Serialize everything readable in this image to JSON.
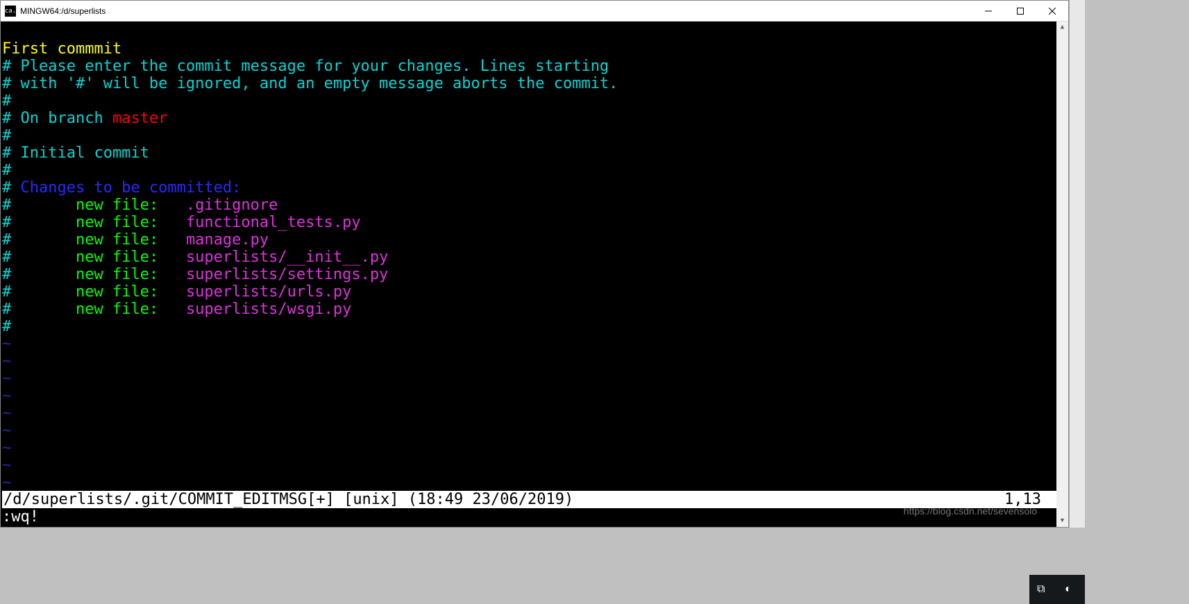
{
  "window": {
    "title": "MINGW64:/d/superlists",
    "icon_text": "ca."
  },
  "editor": {
    "commit_message": "First commmit",
    "comment_line1": "# Please enter the commit message for your changes. Lines starting",
    "comment_line2": "# with '#' will be ignored, and an empty message aborts the commit.",
    "hash_blank": "#",
    "on_branch_prefix": "# On branch ",
    "branch_name": "master",
    "initial_commit": "# Initial commit",
    "changes_prefix": "# ",
    "changes_header": "Changes to be committed:",
    "file_label": "new file:",
    "files": [
      ".gitignore",
      "functional_tests.py",
      "manage.py",
      "superlists/__init__.py",
      "superlists/settings.py",
      "superlists/urls.py",
      "superlists/wsgi.py"
    ],
    "tilde": "~"
  },
  "status": {
    "left": "/d/superlists/.git/COMMIT_EDITMSG[+] [unix] (18:49 23/06/2019)",
    "right": "1,13"
  },
  "command": ":wq!",
  "watermark": "https://blog.csdn.net/sevensolo"
}
